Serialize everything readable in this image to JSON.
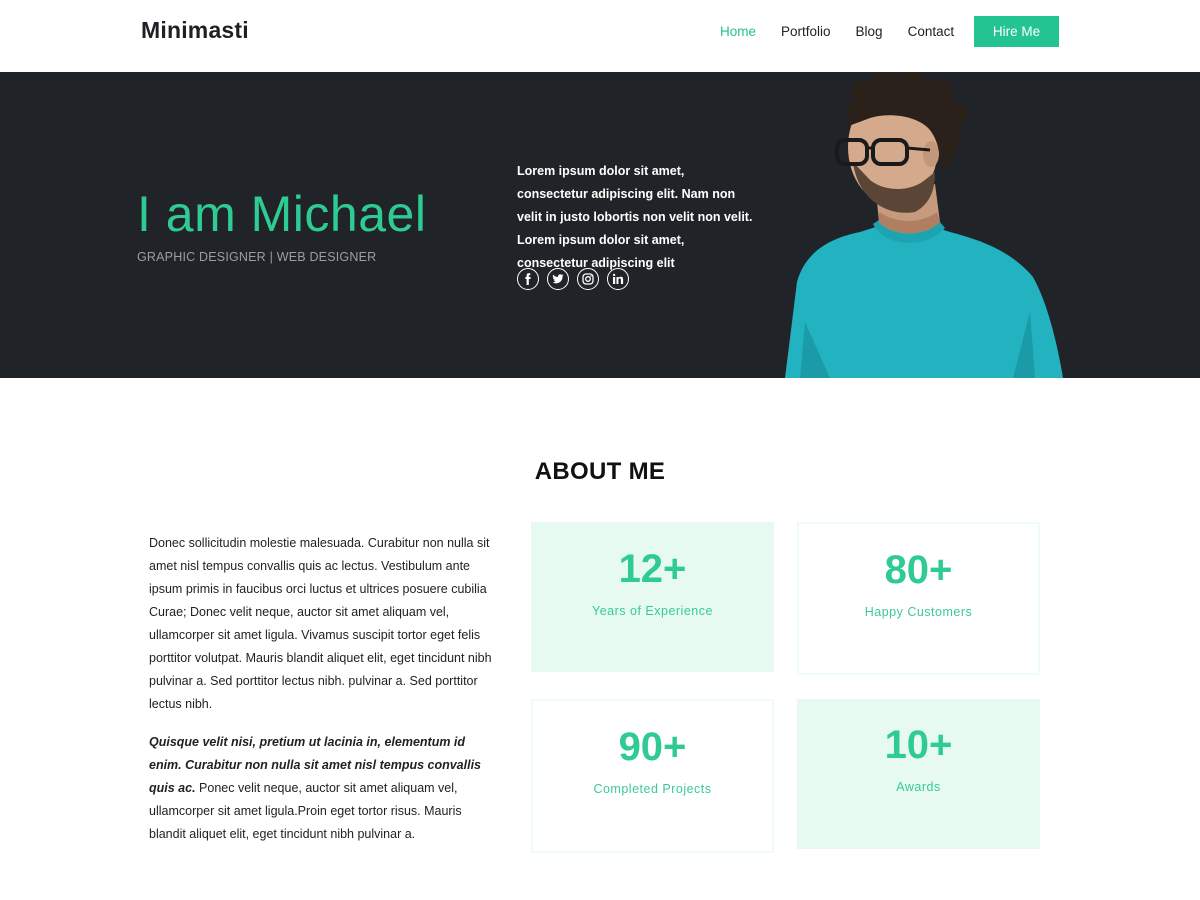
{
  "header": {
    "logo": "Minimasti",
    "nav": [
      {
        "label": "Home",
        "active": true
      },
      {
        "label": "Portfolio",
        "active": false
      },
      {
        "label": "Blog",
        "active": false
      },
      {
        "label": "Contact",
        "active": false
      }
    ],
    "hire_label": "Hire Me"
  },
  "hero": {
    "title": "I am Michael",
    "subtitle": "GRAPHIC DESIGNER | WEB DESIGNER",
    "text": "Lorem ipsum dolor sit amet, consectetur adipiscing elit. Nam non velit in justo lobortis non velit non velit. Lorem ipsum dolor sit amet, consectetur adipiscing elit",
    "socials": [
      "facebook-icon",
      "twitter-icon",
      "instagram-icon",
      "linkedin-icon"
    ]
  },
  "about": {
    "title": "ABOUT ME",
    "paragraph1": "Donec sollicitudin molestie malesuada. Curabitur non nulla sit amet nisl tempus convallis quis ac lectus. Vestibulum ante ipsum primis in faucibus orci luctus et ultrices posuere cubilia Curae; Donec velit neque, auctor sit amet aliquam vel, ullamcorper sit amet ligula. Vivamus suscipit tortor eget felis porttitor volutpat. Mauris blandit aliquet elit, eget tincidunt nibh pulvinar a. Sed porttitor lectus nibh. pulvinar a. Sed porttitor lectus nibh.",
    "paragraph2_em": "Quisque velit nisi, pretium ut lacinia in, elementum id enim. Curabitur non nulla sit amet nisl tempus convallis quis ac.",
    "paragraph2_rest": "Ponec velit neque, auctor sit amet aliquam vel, ullamcorper sit amet ligula.Proin eget tortor risus. Mauris blandit aliquet elit, eget tincidunt nibh pulvinar a.",
    "stats": [
      {
        "value": "12+",
        "label": "Years of Experience"
      },
      {
        "value": "80+",
        "label": "Happy Customers"
      },
      {
        "value": "90+",
        "label": "Completed Projects"
      },
      {
        "value": "10+",
        "label": "Awards"
      }
    ]
  },
  "colors": {
    "accent": "#23c48f",
    "hero_bg": "#202327",
    "stat_fill": "#e6faf2"
  }
}
